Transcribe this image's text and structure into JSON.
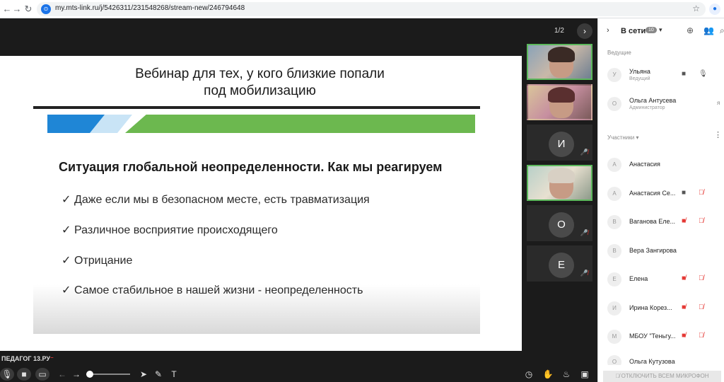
{
  "browser": {
    "url": "my.mts-link.ru/j/5426311/231548268/stream-new/246794648"
  },
  "stage": {
    "slide_counter": "1/2"
  },
  "slide": {
    "title_line1": "Вебинар для тех, у кого близкие попали",
    "title_line2": "под мобилизацию",
    "heading": "Ситуация глобальной неопределенности. Как мы реагируем",
    "bullets": [
      "Даже если мы в безопасном месте, есть травматизация",
      "Различное восприятие происходящего",
      "Отрицание",
      "Самое стабильное в нашей жизни - неопределенность"
    ],
    "colors": {
      "blue": "#1f86d6",
      "green": "#6cb84f",
      "light_blue": "#c9e4f6"
    }
  },
  "brand": {
    "logo_text": "ПЕДАГОГ 13.РУ"
  },
  "thumbs": [
    {
      "type": "camera",
      "active": true
    },
    {
      "type": "camera",
      "active": false
    },
    {
      "type": "avatar",
      "initial": "И",
      "muted": true
    },
    {
      "type": "camera",
      "active": true
    },
    {
      "type": "avatar",
      "initial": "О",
      "muted": true
    },
    {
      "type": "avatar",
      "initial": "Е",
      "muted": true
    }
  ],
  "panel": {
    "title": "В сети",
    "count": "10",
    "section_hosts": "Ведущие",
    "section_participants": "Участники",
    "hosts": [
      {
        "initial": "У",
        "name": "Ульяна",
        "role": "Ведущий"
      },
      {
        "initial": "О",
        "name": "Ольга Антусева",
        "role": "Администратор",
        "extra": "я"
      }
    ],
    "participants": [
      {
        "initial": "А",
        "name": "Анастасия"
      },
      {
        "initial": "А",
        "name": "Анастасия Се..."
      },
      {
        "initial": "В",
        "name": "Ваганова Еле..."
      },
      {
        "initial": "В",
        "name": "Вера Зангирова"
      },
      {
        "initial": "Е",
        "name": "Елена"
      },
      {
        "initial": "И",
        "name": "Ирина Корез..."
      },
      {
        "initial": "М",
        "name": "МБОУ \"Теньгу..."
      },
      {
        "initial": "О",
        "name": "Ольга Кутузова"
      }
    ],
    "mute_all_label": "ОТКЛЮЧИТЬ ВСЕМ МИКРОФОН"
  },
  "accent_colors": {
    "active_border": "#5cb85c",
    "muted": "#e53935"
  }
}
